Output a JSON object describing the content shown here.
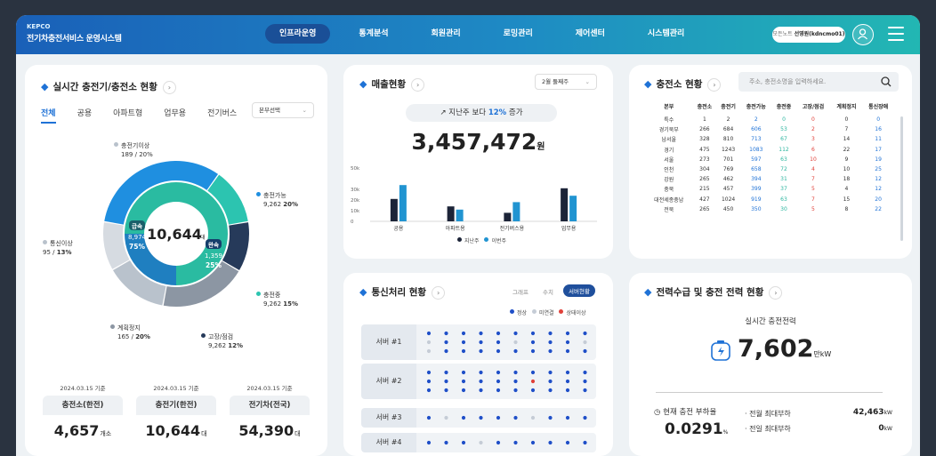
{
  "header": {
    "logo_brand": "KEPCO",
    "logo_title": "전기차충전서비스 운영시스템",
    "nav": [
      {
        "label": "인프라운영",
        "active": true
      },
      {
        "label": "통계분석",
        "active": false
      },
      {
        "label": "회원관리",
        "active": false
      },
      {
        "label": "로밍관리",
        "active": false
      },
      {
        "label": "제어센터",
        "active": false
      },
      {
        "label": "시스템관리",
        "active": false
      }
    ],
    "user_prefix": "모든노트",
    "user_name": "선영원(kdncmo01)",
    "user_icon": "user-icon",
    "menu_icon": "hamburger-icon"
  },
  "realtime": {
    "title": "실시간 충전기/충전소 현황",
    "tabs": [
      "전체",
      "공용",
      "아파트형",
      "업무용",
      "전기버스"
    ],
    "active_tab": "전체",
    "region_select": "본부선택",
    "center_value": "10,644",
    "center_unit": "대",
    "inner_left_label": "급속",
    "inner_left_value": "8,974",
    "inner_left_pct": "75%",
    "inner_right_label": "완속",
    "inner_right_value": "1,359",
    "inner_right_pct": "25%",
    "segments": [
      {
        "name": "충전가능",
        "value": "9,262",
        "pct": "20%",
        "color": "#1f8fe0"
      },
      {
        "name": "충전중",
        "value": "9,262",
        "pct": "15%",
        "color": "#2cc4b0"
      },
      {
        "name": "고장/점검",
        "value": "9,262",
        "pct": "12%",
        "color": "#263a5a"
      },
      {
        "name": "계획정지",
        "value": "165",
        "pct": "20%",
        "color": "#8c96a3"
      },
      {
        "name": "통신이상",
        "value": "95",
        "pct": "13%",
        "color": "#b9c2cc"
      },
      {
        "name": "충전기이상",
        "value": "189",
        "pct": "20%",
        "color": "#d6dbe1"
      }
    ],
    "stats": [
      {
        "date": "2024.03.15 기준",
        "label": "충전소(한전)",
        "value": "4,657",
        "unit": "개소"
      },
      {
        "date": "2024.03.15 기준",
        "label": "충전기(한전)",
        "value": "10,644",
        "unit": "대"
      },
      {
        "date": "2024.03.15 기준",
        "label": "전기차(전국)",
        "value": "54,390",
        "unit": "대"
      }
    ]
  },
  "sales": {
    "title": "매출현황",
    "period_select": "2월 둘째주",
    "compare_prefix": "지난주 보다",
    "compare_pct": "12%",
    "compare_suffix": "증가",
    "total": "3,457,472",
    "unit": "원",
    "legend_prev": "지난주",
    "legend_this": "이번주",
    "color_prev": "#1c2438",
    "color_this": "#2194d1"
  },
  "chart_data": {
    "type": "bar",
    "categories": [
      "공용",
      "아파트용",
      "전기버스용",
      "업무용"
    ],
    "series": [
      {
        "name": "지난주",
        "values": [
          21,
          14,
          8,
          31
        ]
      },
      {
        "name": "이번주",
        "values": [
          34,
          11,
          18,
          24
        ]
      }
    ],
    "yticks": [
      "50k",
      "30k",
      "20k",
      "10k",
      "0"
    ],
    "ylim": [
      0,
      50
    ]
  },
  "stations": {
    "title": "충전소 현황",
    "search_placeholder": "주소, 충전소명을 입력하세요.",
    "search_icon": "search-icon",
    "columns": [
      "본부",
      "충전소",
      "충전기",
      "충전가능",
      "충전중",
      "고장/점검",
      "계획정지",
      "통신장애"
    ],
    "rows": [
      [
        "특수",
        "1",
        "2",
        "2",
        "0",
        "0",
        "0",
        "0"
      ],
      [
        "경기북부",
        "266",
        "684",
        "606",
        "53",
        "2",
        "7",
        "16"
      ],
      [
        "남서울",
        "328",
        "810",
        "713",
        "67",
        "3",
        "14",
        "11"
      ],
      [
        "경기",
        "475",
        "1243",
        "1083",
        "112",
        "6",
        "22",
        "17"
      ],
      [
        "서울",
        "273",
        "701",
        "597",
        "63",
        "10",
        "9",
        "19"
      ],
      [
        "인천",
        "304",
        "769",
        "658",
        "72",
        "4",
        "10",
        "25"
      ],
      [
        "강원",
        "265",
        "462",
        "394",
        "31",
        "7",
        "18",
        "12"
      ],
      [
        "충북",
        "215",
        "457",
        "399",
        "37",
        "5",
        "4",
        "12"
      ],
      [
        "대전세종충남",
        "427",
        "1024",
        "919",
        "63",
        "7",
        "15",
        "20"
      ],
      [
        "전북",
        "265",
        "450",
        "350",
        "30",
        "5",
        "8",
        "22"
      ]
    ],
    "col_colors": [
      "#333",
      "#333",
      "#333",
      "#1f72d6",
      "#2cb59f",
      "#e0413a",
      "#333",
      "#1f72d6"
    ]
  },
  "comm": {
    "title": "통신처리 현황",
    "views": [
      "그래프",
      "수치",
      "서버현황"
    ],
    "active_view": "서버현황",
    "legend": [
      {
        "label": "정상",
        "color": "#1f4fc8"
      },
      {
        "label": "미연결",
        "color": "#c5ccd6"
      },
      {
        "label": "상태이상",
        "color": "#e0413a"
      }
    ],
    "servers": [
      {
        "name": "서버 #1",
        "dots": [
          "n",
          "n",
          "n",
          "n",
          "n",
          "n",
          "n",
          "n",
          "n",
          "n",
          "g",
          "n",
          "n",
          "n",
          "n",
          "g",
          "n",
          "n",
          "n",
          "g",
          "g",
          "n",
          "n",
          "n",
          "n",
          "n",
          "n",
          "n",
          "n",
          "n"
        ]
      },
      {
        "name": "서버 #2",
        "dots": [
          "n",
          "n",
          "n",
          "n",
          "n",
          "n",
          "n",
          "n",
          "n",
          "n",
          "n",
          "n",
          "n",
          "n",
          "n",
          "n",
          "r",
          "n",
          "n",
          "n",
          "n",
          "n",
          "n",
          "n",
          "n",
          "n",
          "n",
          "n",
          "n",
          "n"
        ]
      },
      {
        "name": "서버 #3",
        "dots": [
          "n",
          "g",
          "n",
          "n",
          "n",
          "n",
          "g",
          "n",
          "n",
          "n"
        ]
      },
      {
        "name": "서버 #4",
        "dots": [
          "n",
          "n",
          "n",
          "g",
          "n",
          "n",
          "n",
          "n",
          "n",
          "n"
        ]
      }
    ]
  },
  "power": {
    "title": "전력수급 및 충전 전력 현황",
    "realtime_label": "실시간 충전전력",
    "battery_icon": "battery-icon",
    "value": "7,602",
    "unit": "만kW",
    "load_label": "현재 충전 부하율",
    "load_value": "0.0291",
    "load_unit": "%",
    "clock_icon": "clock-icon",
    "month_label": "· 전월 최대부하",
    "month_value": "42,463",
    "month_unit": "kW",
    "day_label": "· 전일 최대부하",
    "day_value": "0",
    "day_unit": "kW"
  }
}
